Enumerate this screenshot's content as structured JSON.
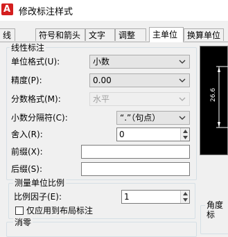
{
  "window": {
    "title": "修改标注样式"
  },
  "tabs": [
    {
      "label": "线"
    },
    {
      "label": "符号和箭头"
    },
    {
      "label": "文字"
    },
    {
      "label": "调整"
    },
    {
      "label": "主单位"
    },
    {
      "label": "换算单位"
    }
  ],
  "linear": {
    "group_title": "线性标注",
    "unit_format": {
      "label": "单位格式(U):",
      "value": "小数"
    },
    "precision": {
      "label": "精度(P):",
      "value": "0.00"
    },
    "fraction_format": {
      "label": "分数格式(M):",
      "value": "水平"
    },
    "decimal_separator": {
      "label": "小数分隔符(C):",
      "value": "“.”（句点）"
    },
    "round_off": {
      "label": "舍入(R):",
      "value": "0"
    },
    "prefix": {
      "label": "前缀(X):",
      "value": ""
    },
    "suffix": {
      "label": "后缀(S):",
      "value": ""
    }
  },
  "measurement_scale": {
    "group_title": "测量单位比例",
    "scale_factor": {
      "label": "比例因子(E):",
      "value": "1"
    },
    "apply_to_layout": {
      "label": "仅应用到布局标注",
      "checked": false
    }
  },
  "zero_suppression": {
    "group_title": "消零"
  },
  "angular": {
    "group_title": "角度标"
  },
  "preview": {
    "dimension_text": "26.6"
  },
  "colors": {
    "window_bg": "#f0f0f0",
    "preview_bg": "#000000",
    "app_icon": "#d41f1f",
    "group_border": "#d5dfe5"
  }
}
